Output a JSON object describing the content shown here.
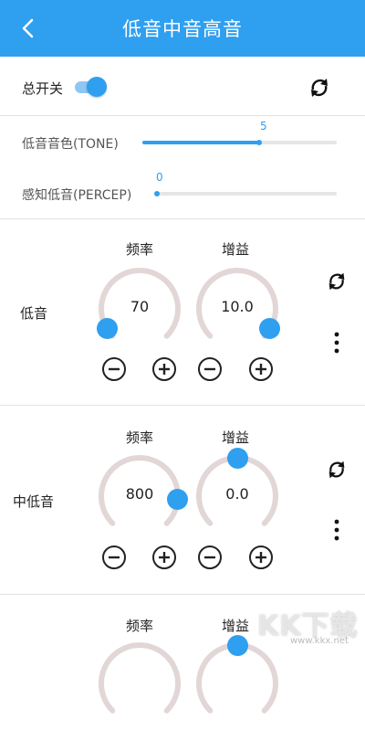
{
  "header": {
    "title": "低音中音高音",
    "back_icon": "back-chevron-icon"
  },
  "master": {
    "label": "总开关",
    "enabled": true,
    "refresh_icon": "refresh-icon"
  },
  "sliders": [
    {
      "label": "低音音色(TONE)",
      "value": "5",
      "fraction": 0.6
    },
    {
      "label": "感知低音(PERCEP)",
      "value": "0",
      "fraction": 0.0
    }
  ],
  "bands": [
    {
      "label": "低音",
      "freq_head": "频率",
      "gain_head": "增益",
      "freq_value": "70",
      "gain_value": "10.0",
      "freq_level": 0.05,
      "gain_level": 0.95
    },
    {
      "label": "中低音",
      "freq_head": "频率",
      "gain_head": "增益",
      "freq_value": "800",
      "gain_value": "0.0",
      "freq_level": 0.85,
      "gain_level": 0.5
    },
    {
      "label": "",
      "freq_head": "频率",
      "gain_head": "增益",
      "freq_value": "",
      "gain_value": "",
      "freq_level": 0.05,
      "gain_level": 0.5
    }
  ],
  "accent_color": "#2f9ff0",
  "watermark": {
    "main": "KK下载",
    "sub": "www.kkx.net"
  }
}
